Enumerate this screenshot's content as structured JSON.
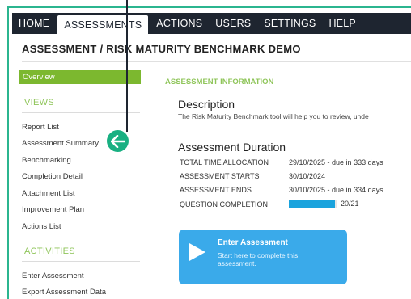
{
  "nav": {
    "items": [
      {
        "label": "HOME"
      },
      {
        "label": "ASSESSMENTS"
      },
      {
        "label": "ACTIONS"
      },
      {
        "label": "USERS"
      },
      {
        "label": "SETTINGS"
      },
      {
        "label": "HELP"
      }
    ],
    "active": "ASSESSMENTS"
  },
  "page": {
    "title": "ASSESSMENT / RISK MATURITY BENCHMARK DEMO"
  },
  "sidebar": {
    "overview": "Overview",
    "views_header": "VIEWS",
    "views": [
      {
        "label": "Report List"
      },
      {
        "label": "Assessment Summary"
      },
      {
        "label": "Benchmarking"
      },
      {
        "label": "Completion Detail"
      },
      {
        "label": "Attachment List"
      },
      {
        "label": "Improvement Plan"
      },
      {
        "label": "Actions List"
      }
    ],
    "activities_header": "ACTIVITIES",
    "activities": [
      {
        "label": "Enter Assessment"
      },
      {
        "label": "Export Assessment Data"
      }
    ]
  },
  "main": {
    "info_header": "ASSESSMENT INFORMATION",
    "description_header": "Description",
    "description_text": "The Risk Maturity Benchmark tool will help you to review, unde",
    "duration_header": "Assessment Duration",
    "rows": [
      {
        "label": "TOTAL TIME ALLOCATION",
        "value": "29/10/2025 - due in 333 days"
      },
      {
        "label": "ASSESSMENT STARTS",
        "value": "30/10/2024"
      },
      {
        "label": "ASSESSMENT ENDS",
        "value": "30/10/2025 - due in 334 days"
      },
      {
        "label": "QUESTION COMPLETION",
        "value": ""
      }
    ],
    "completion": {
      "fraction": 0.952,
      "text": "20/21"
    },
    "cta": {
      "title": "Enter Assessment",
      "subtitle": "Start here to complete this assessment."
    }
  },
  "colors": {
    "accent": "#2bb58f",
    "nav": "#1e2530",
    "overview": "#7cb82f",
    "cta": "#3aaaea",
    "progress": "#1aa3dd"
  },
  "icons": {
    "pointer": "arrow-left-icon",
    "play": "play-icon"
  }
}
